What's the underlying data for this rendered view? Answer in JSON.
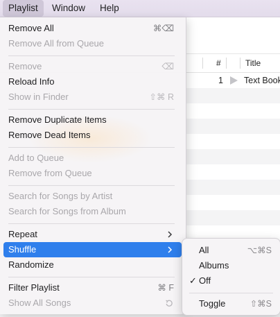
{
  "menubar": {
    "items": [
      "Playlist",
      "Window",
      "Help"
    ]
  },
  "table": {
    "headers": {
      "number": "#",
      "title": "Title"
    },
    "rows": [
      {
        "number": "1",
        "title": "Text Book"
      }
    ]
  },
  "menu": {
    "items": [
      {
        "label": "Remove All",
        "shortcut": "⌘⌫",
        "enabled": true
      },
      {
        "label": "Remove All from Queue",
        "shortcut": "",
        "enabled": false
      },
      {
        "label": "Remove",
        "shortcut": "⌫",
        "enabled": false
      },
      {
        "label": "Reload Info",
        "shortcut": "",
        "enabled": true
      },
      {
        "label": "Show in Finder",
        "shortcut": "⇧⌘ R",
        "enabled": false
      },
      {
        "label": "Remove Duplicate Items",
        "shortcut": "",
        "enabled": true
      },
      {
        "label": "Remove Dead Items",
        "shortcut": "",
        "enabled": true
      },
      {
        "label": "Add to Queue",
        "shortcut": "",
        "enabled": false
      },
      {
        "label": "Remove from Queue",
        "shortcut": "",
        "enabled": false
      },
      {
        "label": "Search for Songs by Artist",
        "shortcut": "",
        "enabled": false
      },
      {
        "label": "Search for Songs from Album",
        "shortcut": "",
        "enabled": false
      },
      {
        "label": "Repeat",
        "shortcut": "",
        "enabled": true
      },
      {
        "label": "Shuffle",
        "shortcut": "",
        "enabled": true,
        "selected": true
      },
      {
        "label": "Randomize",
        "shortcut": "",
        "enabled": true
      },
      {
        "label": "Filter Playlist",
        "shortcut": "⌘ F",
        "enabled": true
      },
      {
        "label": "Show All Songs",
        "shortcut": "",
        "enabled": false
      }
    ]
  },
  "submenu": {
    "items": [
      {
        "label": "All",
        "shortcut": "⌥⌘S",
        "checked": false
      },
      {
        "label": "Albums",
        "shortcut": "",
        "checked": false
      },
      {
        "label": "Off",
        "shortcut": "",
        "checked": true
      },
      {
        "label": "Toggle",
        "shortcut": "⇧⌘S",
        "checked": false
      }
    ],
    "check_glyph": "✓"
  },
  "colors": {
    "highlight": "#2f7fec",
    "disabled_text": "#a9a7ab"
  }
}
